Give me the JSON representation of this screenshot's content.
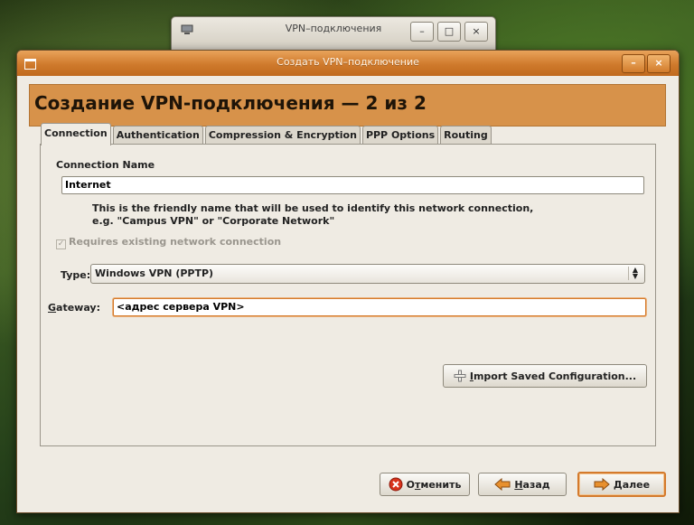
{
  "background_window": {
    "title": "VPN–подключения",
    "minimize": "–",
    "maximize": "□",
    "close": "×"
  },
  "dialog": {
    "title": "Создать VPN–подключение",
    "minimize": "–",
    "close": "×",
    "heading": "Создание VPN-подключения — 2 из 2"
  },
  "tabs": [
    {
      "label": "Connection",
      "active": true
    },
    {
      "label": "Authentication",
      "active": false
    },
    {
      "label": "Compression & Encryption",
      "active": false
    },
    {
      "label": "PPP Options",
      "active": false
    },
    {
      "label": "Routing",
      "active": false
    }
  ],
  "connection": {
    "name_label": "Connection Name",
    "name_value": "Internet",
    "help_line1": "This is the friendly name that will be used to identify this network connection,",
    "help_line2": "e.g. \"Campus VPN\" or \"Corporate Network\"",
    "requires_label": "Requires existing network connection",
    "requires_checked": true,
    "type_label": "Type:",
    "type_value": "Windows VPN (PPTP)",
    "gateway_label_underlined": "G",
    "gateway_label_rest": "ateway:",
    "gateway_value": "<адрес сервера VPN>",
    "import_underlined": "I",
    "import_rest": "mport Saved Configuration..."
  },
  "buttons": {
    "cancel_prefix": "О",
    "cancel_underlined": "т",
    "cancel_rest": "менить",
    "back_underlined": "Н",
    "back_rest": "азад",
    "next_underlined": "Д",
    "next_rest": "алее"
  },
  "colors": {
    "accent": "#d47a2c",
    "banner": "#d7924a",
    "dialog_bg": "#efebe3"
  },
  "icons": {
    "import": "plus-icon",
    "cancel": "cancel-icon",
    "back": "arrow-left-icon",
    "next": "arrow-right-icon"
  }
}
